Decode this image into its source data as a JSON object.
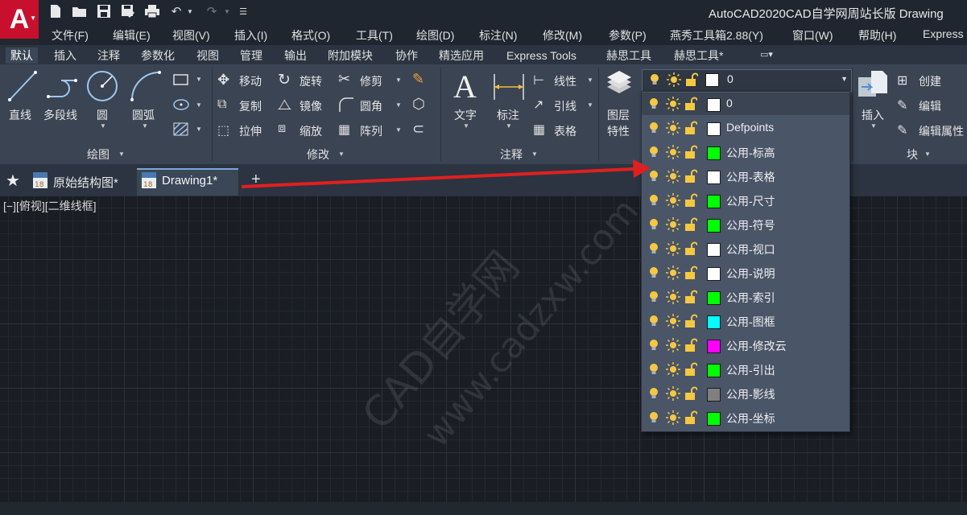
{
  "title_bar": {
    "app_letter": "A",
    "title": "AutoCAD2020CAD自学网周站长版  Drawing"
  },
  "menu": [
    "文件(F)",
    "编辑(E)",
    "视图(V)",
    "插入(I)",
    "格式(O)",
    "工具(T)",
    "绘图(D)",
    "标注(N)",
    "修改(M)",
    "参数(P)",
    "燕秀工具箱2.88(Y)",
    "窗口(W)",
    "帮助(H)",
    "Express"
  ],
  "ribbon_tabs": [
    "默认",
    "插入",
    "注释",
    "参数化",
    "视图",
    "管理",
    "输出",
    "附加模块",
    "协作",
    "精选应用",
    "Express Tools",
    "赫思工具",
    "赫思工具*"
  ],
  "ribbon": {
    "draw": {
      "title": "绘图",
      "line": "直线",
      "polyline": "多段线",
      "circle": "圆",
      "arc": "圆弧"
    },
    "modify": {
      "title": "修改",
      "move": "移动",
      "rotate": "旋转",
      "trim": "修剪",
      "copy": "复制",
      "mirror": "镜像",
      "fillet": "圆角",
      "stretch": "拉伸",
      "scale": "缩放",
      "array": "阵列"
    },
    "annotation": {
      "title": "注释",
      "text": "文字",
      "dimension": "标注",
      "linear": "线性",
      "leader": "引线",
      "table": "表格"
    },
    "layers": {
      "props_line1": "图层",
      "props_line2": "特性",
      "current": "0"
    },
    "block": {
      "title": "块",
      "insert": "插入",
      "create": "创建",
      "edit": "编辑",
      "edit_attr": "编辑属性"
    }
  },
  "file_tabs": {
    "tab1": "原始结构图*",
    "tab2": "Drawing1*",
    "add": "+"
  },
  "viewport_label": "[−][俯视][二维线框]",
  "layers": [
    {
      "name": "0",
      "color": "#ffffff"
    },
    {
      "name": "Defpoints",
      "color": "#ffffff"
    },
    {
      "name": "公用-标高",
      "color": "#00ff00"
    },
    {
      "name": "公用-表格",
      "color": "#ffffff"
    },
    {
      "name": "公用-尺寸",
      "color": "#00ff00"
    },
    {
      "name": "公用-符号",
      "color": "#00ff00"
    },
    {
      "name": "公用-视口",
      "color": "#ffffff"
    },
    {
      "name": "公用-说明",
      "color": "#ffffff"
    },
    {
      "name": "公用-索引",
      "color": "#00ff00"
    },
    {
      "name": "公用-图框",
      "color": "#00ffff"
    },
    {
      "name": "公用-修改云",
      "color": "#ff00ff"
    },
    {
      "name": "公用-引出",
      "color": "#00ff00"
    },
    {
      "name": "公用-影线",
      "color": "#808080"
    },
    {
      "name": "公用-坐标",
      "color": "#00ff00"
    }
  ],
  "watermark": {
    "line1": "CAD自学网",
    "line2": "www.cadzxw.com"
  },
  "colors": {
    "arrow": "#e02020",
    "accent": "#c8102e"
  }
}
